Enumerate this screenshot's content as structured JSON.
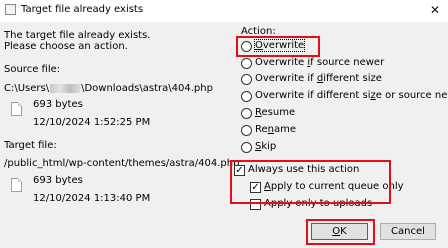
{
  "window": {
    "title": "Target file already exists",
    "close_glyph": "✕"
  },
  "message": {
    "line1": "The target file already exists.",
    "line2": "Please choose an action."
  },
  "source": {
    "label": "Source file:",
    "path_prefix": "C:\\Users\\",
    "path_suffix": "\\Downloads\\astra\\404.php",
    "size": "693 bytes",
    "date": "12/10/2024 1:52:25 PM"
  },
  "target": {
    "label": "Target file:",
    "path": "/public_html/wp-content/themes/astra/404.php",
    "size": "693 bytes",
    "date": "12/10/2024 1:13:40 PM"
  },
  "action": {
    "label": "Action:",
    "options": [
      {
        "pre": "",
        "u": "O",
        "post": "verwrite",
        "selected": true
      },
      {
        "pre": "Overwrite ",
        "u": "i",
        "post": "f source newer",
        "selected": false
      },
      {
        "pre": "Overwrite if ",
        "u": "d",
        "post": "ifferent size",
        "selected": false
      },
      {
        "pre": "Overwrite if different si",
        "u": "z",
        "post": "e or source newer",
        "selected": false
      },
      {
        "pre": "",
        "u": "R",
        "post": "esume",
        "selected": false
      },
      {
        "pre": "Re",
        "u": "n",
        "post": "ame",
        "selected": false
      },
      {
        "pre": "",
        "u": "S",
        "post": "kip",
        "selected": false
      }
    ]
  },
  "always": {
    "label": "Always use this action",
    "checked": true,
    "current_queue": {
      "pre": "",
      "u": "A",
      "post": "pply to current queue only",
      "checked": true
    },
    "uploads_only": {
      "pre": "Apply only to uploads",
      "checked": false
    }
  },
  "buttons": {
    "ok": {
      "pre": "",
      "u": "O",
      "post": "K"
    },
    "cancel": "Cancel"
  },
  "colors": {
    "highlight": "#e0101b",
    "dialog_bg": "#f0f0f0"
  }
}
